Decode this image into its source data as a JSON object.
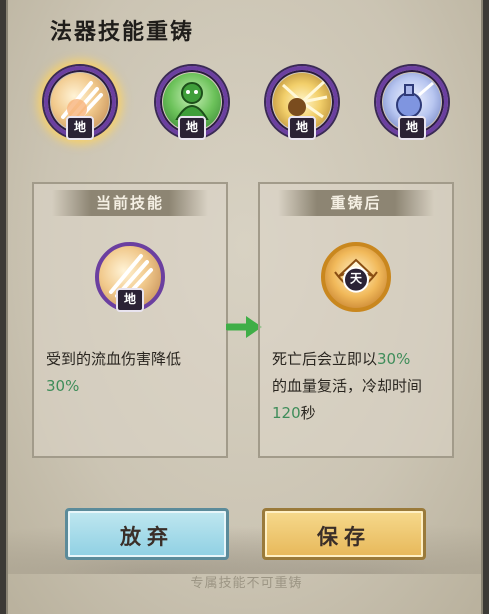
{
  "title": "法器技能重铸",
  "skills": [
    {
      "icon": "claw-slash-skill-icon",
      "badge": "地",
      "selected": true
    },
    {
      "icon": "green-figure-skill-icon",
      "badge": "地",
      "selected": false
    },
    {
      "icon": "golden-burst-skill-icon",
      "badge": "地",
      "selected": false
    },
    {
      "icon": "blue-flask-skill-icon",
      "badge": "地",
      "selected": false
    }
  ],
  "current": {
    "header": "当前技能",
    "icon_badge": "地",
    "desc_text": "受到的流血伤害降低",
    "desc_value": "30%"
  },
  "recast": {
    "header": "重铸后",
    "icon_badge": "天",
    "desc_text1": "死亡后会立即以",
    "desc_value1": "30%",
    "desc_text2": "的血量复活，冷却时间",
    "desc_value2": "120",
    "desc_text3": "秒"
  },
  "buttons": {
    "cancel": "放弃",
    "save": "保存"
  },
  "footer": "专属技能不可重铸",
  "colors": {
    "accent_green": "#3f8d5a",
    "ring_purple": "#6b3fa0",
    "cancel_blue": "#8fd0e3",
    "save_gold": "#e7b85a"
  }
}
